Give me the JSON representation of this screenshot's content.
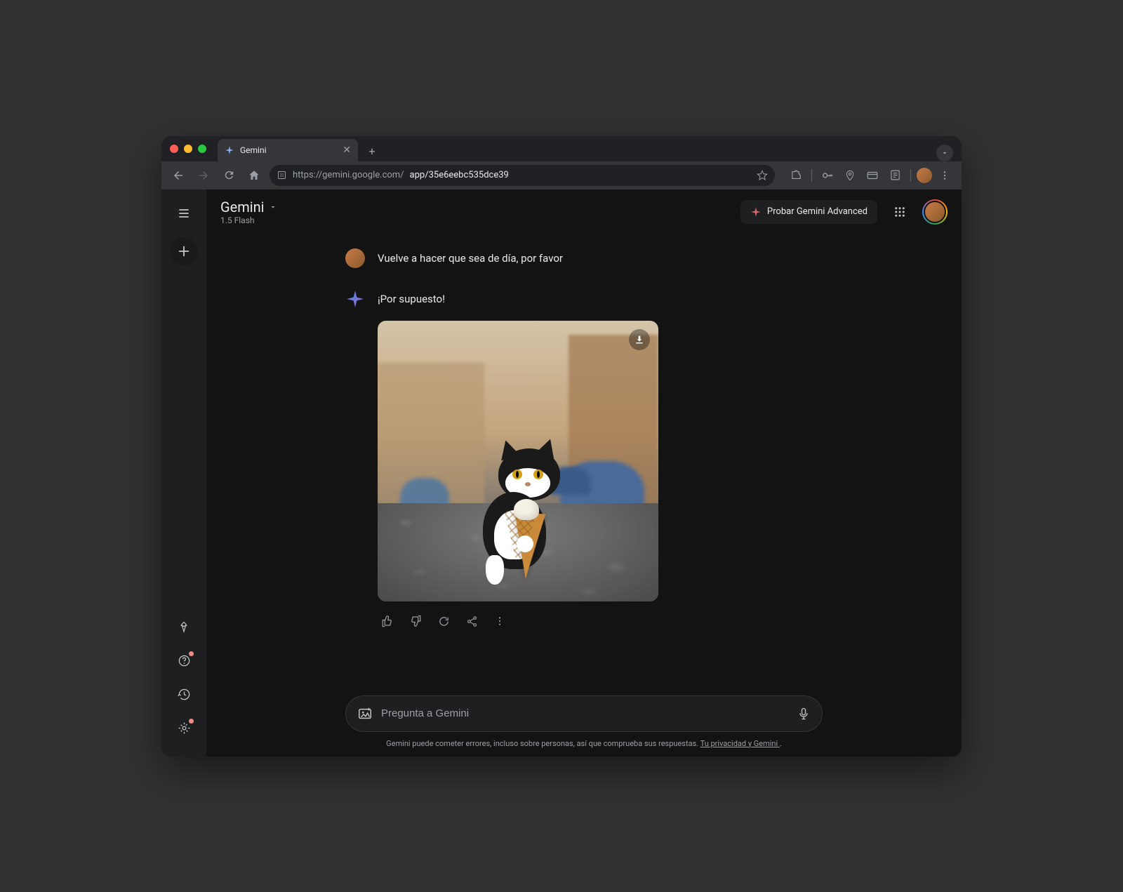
{
  "browser": {
    "tab_title": "Gemini",
    "url_base": "https://gemini.google.com/",
    "url_path": "app/35e6eebc535dce39"
  },
  "header": {
    "title": "Gemini",
    "model": "1.5 Flash",
    "advanced_button": "Probar Gemini Advanced"
  },
  "conversation": {
    "user_message": "Vuelve a hacer que sea de día, por favor",
    "ai_message": "¡Por supuesto!"
  },
  "input": {
    "placeholder": "Pregunta a Gemini"
  },
  "footer": {
    "disclaimer_text": "Gemini puede cometer errores, incluso sobre personas, así que comprueba sus respuestas. ",
    "disclaimer_link": "Tu privacidad y Gemini ",
    "disclaimer_end": "."
  }
}
